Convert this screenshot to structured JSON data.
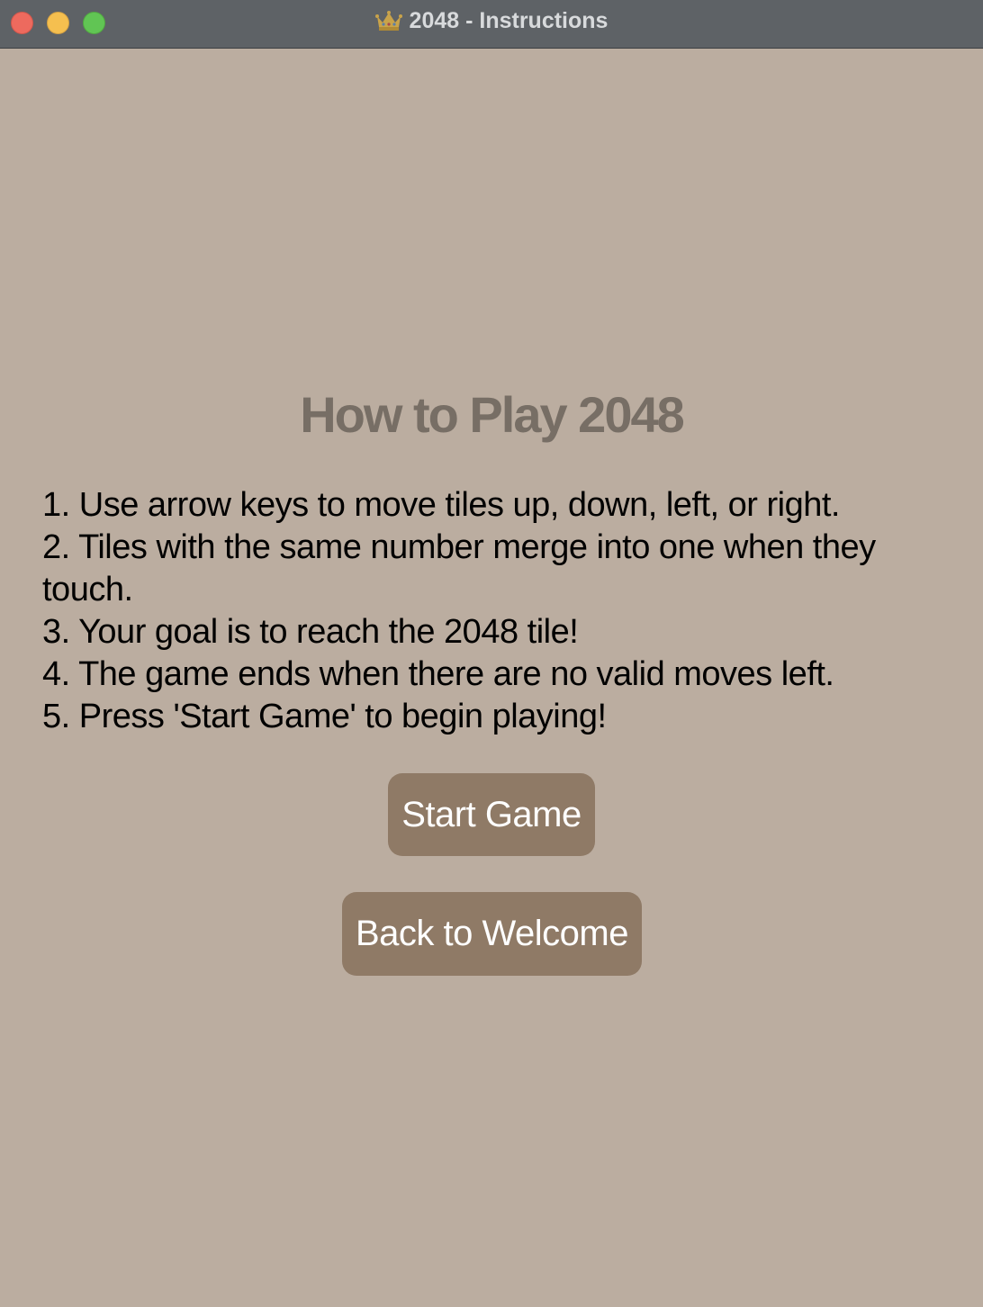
{
  "window": {
    "title": "2048 - Instructions",
    "title_icon": "crown-icon"
  },
  "traffic_lights": {
    "close": "close-icon",
    "minimize": "minimize-icon",
    "zoom": "zoom-icon"
  },
  "page": {
    "heading": "How to Play 2048",
    "instructions": [
      "1. Use arrow keys to move tiles up, down, left, or right.",
      "2. Tiles with the same number merge into one when they touch.",
      "3. Your goal is to reach the 2048 tile!",
      "4. The game ends when there are no valid moves left.",
      "5. Press 'Start Game' to begin playing!"
    ],
    "start_button": "Start Game",
    "back_button": "Back to Welcome"
  },
  "colors": {
    "background": "#bbada0",
    "heading": "#776e65",
    "button": "#8f7a66",
    "button_text": "#ffffff",
    "titlebar": "#5e6266"
  }
}
